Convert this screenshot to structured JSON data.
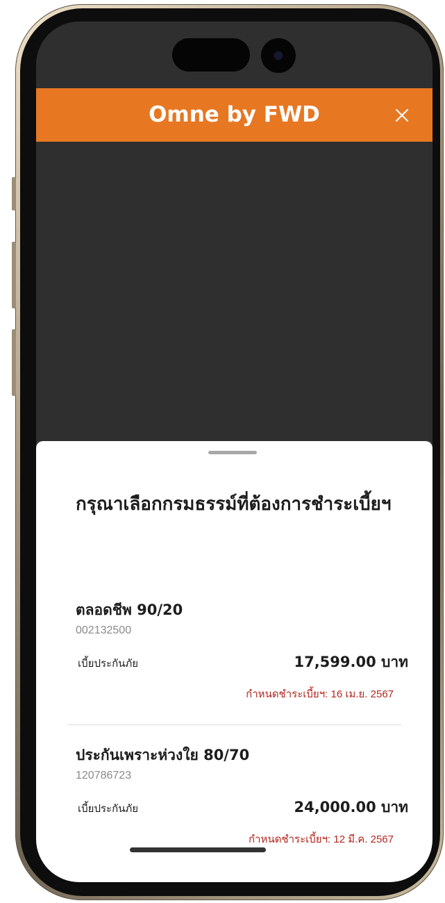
{
  "app": {
    "title": "Omne by FWD",
    "accent_color": "#e87722",
    "close_icon": "close-icon"
  },
  "sheet": {
    "title": "กรุณาเลือกกรมธรรม์ที่ต้องการชำระเบี้ยฯ",
    "policies": [
      {
        "name": "ตลอดชีพ 90/20",
        "number": "002132500",
        "premium_label": "เบี้ยประกันภัย",
        "amount": "17,599.00 บาท",
        "due": "กำหนดชำระเบี้ยฯ: 16 เม.ย. 2567"
      },
      {
        "name": "ประกันเพราะห่วงใย 80/70",
        "number": "120786723",
        "premium_label": "เบี้ยประกันภัย",
        "amount": "24,000.00 บาท",
        "due": "กำหนดชำระเบี้ยฯ: 12 มี.ค. 2567"
      }
    ]
  }
}
